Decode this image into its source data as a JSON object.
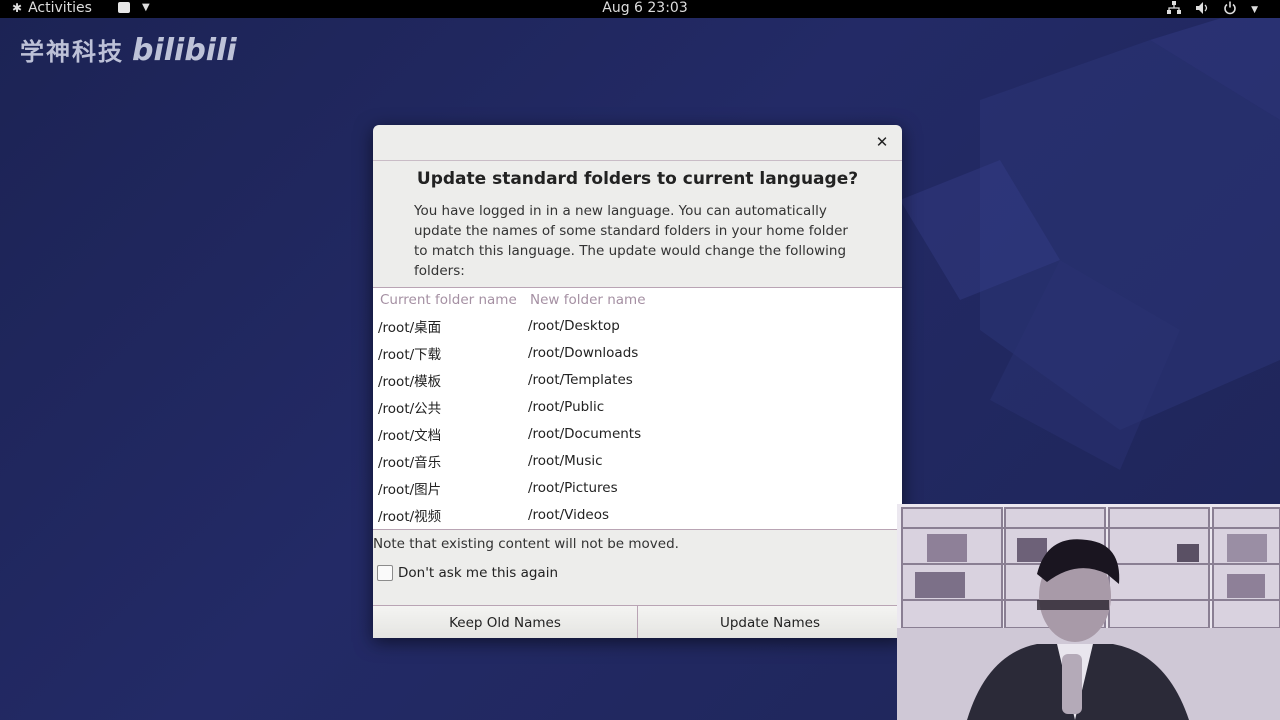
{
  "topbar": {
    "activities_label": "Activities",
    "clock": "Aug 6  23:03",
    "tray_icons": [
      "network-icon",
      "volume-icon",
      "power-icon"
    ]
  },
  "watermark": {
    "text": "学神科技",
    "logo_text": "bilibili"
  },
  "dialog": {
    "title": "Update standard folders to current language?",
    "description": "You have logged in in a new language. You can automatically update the names of some standard folders in your home folder to match this language. The update would change the following folders:",
    "columns": [
      "Current folder name",
      "New folder name"
    ],
    "rows": [
      [
        "/root/桌面",
        "/root/Desktop"
      ],
      [
        "/root/下载",
        "/root/Downloads"
      ],
      [
        "/root/模板",
        "/root/Templates"
      ],
      [
        "/root/公共",
        "/root/Public"
      ],
      [
        "/root/文档",
        "/root/Documents"
      ],
      [
        "/root/音乐",
        "/root/Music"
      ],
      [
        "/root/图片",
        "/root/Pictures"
      ],
      [
        "/root/视频",
        "/root/Videos"
      ]
    ],
    "note": "Note that existing content will not be moved.",
    "checkbox_label": "Don't ask me this again",
    "checkbox_checked": false,
    "keep_label": "Keep Old Names",
    "update_label": "Update Names"
  },
  "colors": {
    "desktop_bg": "#1f2660",
    "dialog_bg": "#ededeb",
    "header_text": "#a590a3"
  }
}
